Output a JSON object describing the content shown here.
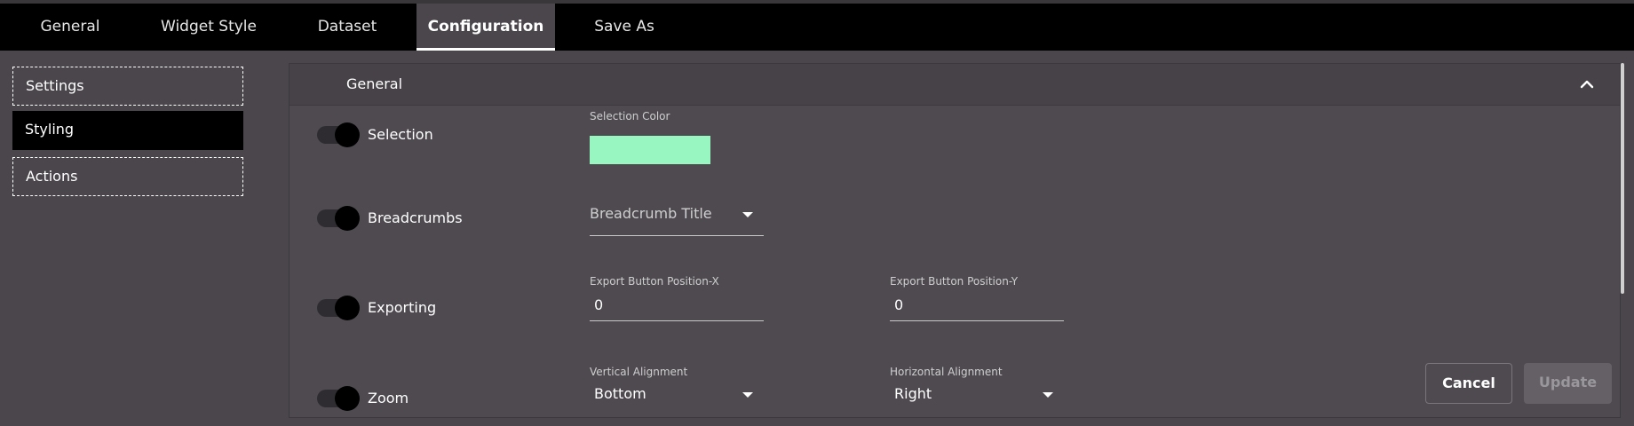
{
  "tabs": [
    {
      "label": "General"
    },
    {
      "label": "Widget Style"
    },
    {
      "label": "Dataset"
    },
    {
      "label": "Configuration",
      "active": true
    },
    {
      "label": "Save As"
    }
  ],
  "sidebar": {
    "items": [
      {
        "label": "Settings"
      },
      {
        "label": "Styling",
        "active": true
      },
      {
        "label": "Actions"
      }
    ]
  },
  "panel": {
    "title": "General",
    "collapse_icon": "chevron-up-icon",
    "selection": {
      "label": "Selection",
      "enabled": true,
      "color_label": "Selection Color",
      "color": "#98f6c0"
    },
    "breadcrumbs": {
      "label": "Breadcrumbs",
      "enabled": true,
      "title_placeholder": "Breadcrumb Title"
    },
    "exporting": {
      "label": "Exporting",
      "enabled": true,
      "pos_x_label": "Export Button Position-X",
      "pos_x_value": "0",
      "pos_y_label": "Export Button Position-Y",
      "pos_y_value": "0"
    },
    "zoom": {
      "label": "Zoom",
      "enabled": true,
      "vertical_label": "Vertical Alignment",
      "vertical_value": "Bottom",
      "horizontal_label": "Horizontal Alignment",
      "horizontal_value": "Right"
    }
  },
  "actions": {
    "cancel_label": "Cancel",
    "update_label": "Update"
  },
  "colors": {
    "background": "#4a464c",
    "topbar": "#000000",
    "selection_color": "#98f6c0"
  }
}
